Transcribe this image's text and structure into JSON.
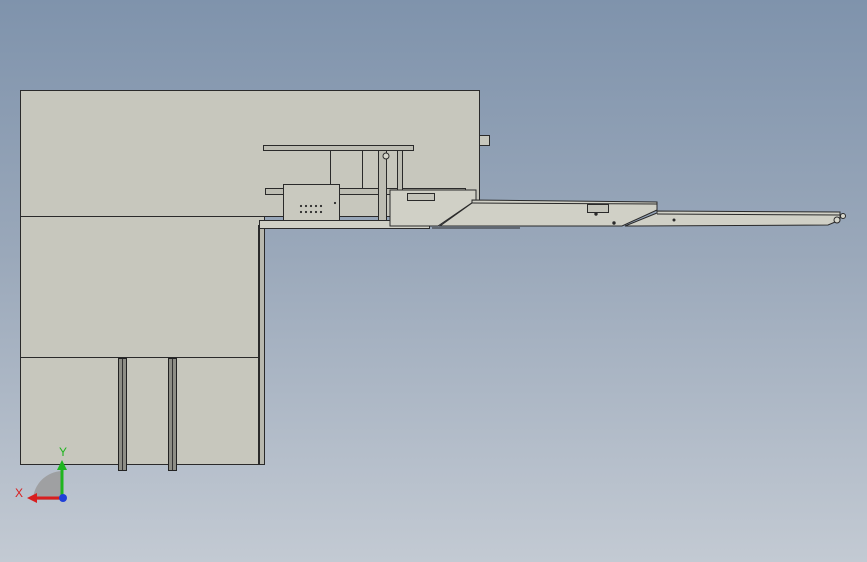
{
  "viewport": {
    "background_top": "#7f93ac",
    "background_bottom": "#c3cad3"
  },
  "model": {
    "body_color": "#c7c7bd",
    "edge_color": "#2a2a2a",
    "conveyor_color": "#d0d0c6"
  },
  "triad": {
    "x_label": "X",
    "y_label": "Y",
    "x_color": "#d81e1e",
    "y_color": "#1fb51f",
    "z_color": "#1f3fd8"
  }
}
